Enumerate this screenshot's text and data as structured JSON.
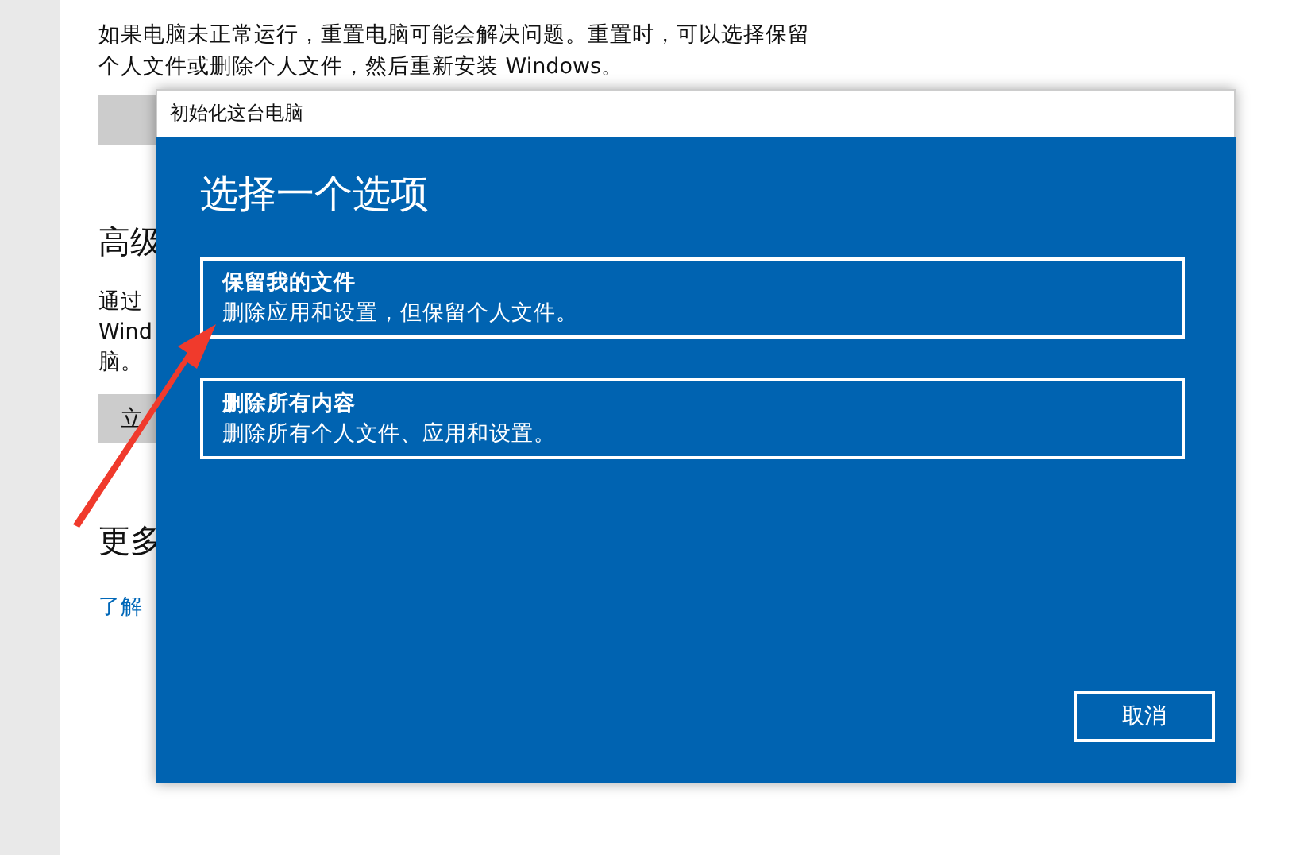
{
  "settings": {
    "description": "如果电脑未正常运行，重置电脑可能会解决问题。重置时，可以选择保留个人文件或删除个人文件，然后重新安装 Windows。",
    "advanced_heading": "高级",
    "advanced_lines": [
      "通过",
      "Wind",
      "脑。"
    ],
    "advanced_button": "立",
    "more_heading": "更多",
    "link": "了解"
  },
  "dialog": {
    "title": "初始化这台电脑",
    "heading": "选择一个选项",
    "options": [
      {
        "title": "保留我的文件",
        "description": "删除应用和设置，但保留个人文件。"
      },
      {
        "title": "删除所有内容",
        "description": "删除所有个人文件、应用和设置。"
      }
    ],
    "cancel": "取消"
  }
}
